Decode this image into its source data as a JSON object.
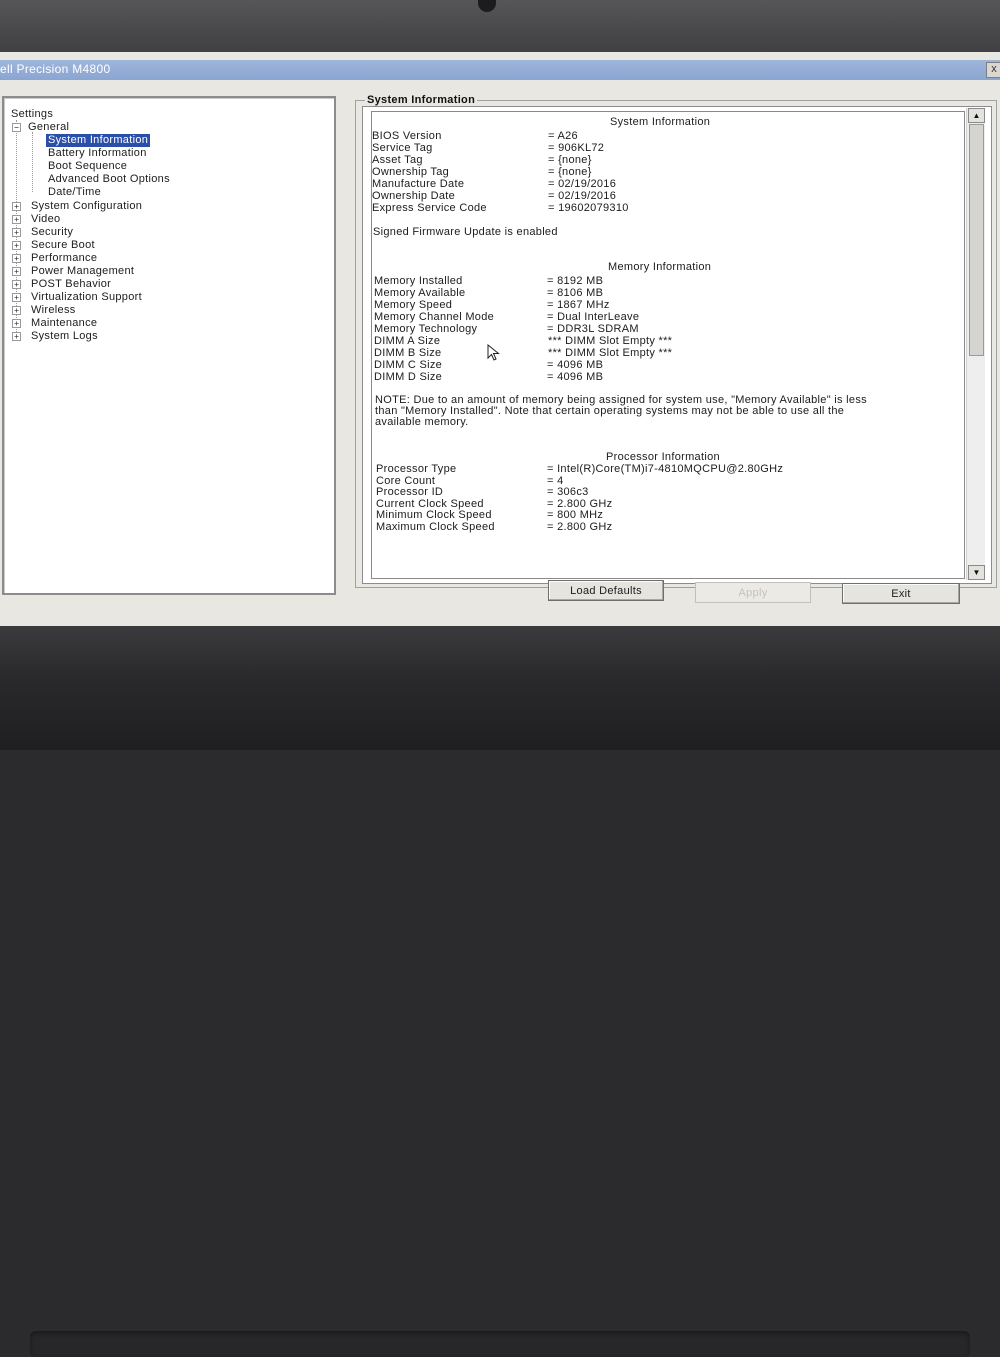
{
  "window": {
    "title": "ell Precision M4800",
    "close_label": "x"
  },
  "tree": {
    "root": "Settings",
    "general": "General",
    "general_items": [
      "System Information",
      "Battery Information",
      "Boot Sequence",
      "Advanced Boot Options",
      "Date/Time"
    ],
    "selected": "System Information",
    "categories": [
      "System Configuration",
      "Video",
      "Security",
      "Secure Boot",
      "Performance",
      "Power Management",
      "POST Behavior",
      "Virtualization Support",
      "Wireless",
      "Maintenance",
      "System Logs"
    ]
  },
  "group_title": "System Information",
  "system": {
    "heading": "System Information",
    "rows": [
      {
        "label": "BIOS Version",
        "value": "= A26"
      },
      {
        "label": "Service Tag",
        "value": "= 906KL72"
      },
      {
        "label": "Asset Tag",
        "value": "= {none}"
      },
      {
        "label": "Ownership Tag",
        "value": "= {none}"
      },
      {
        "label": "Manufacture Date",
        "value": "= 02/19/2016"
      },
      {
        "label": "Ownership Date",
        "value": "= 02/19/2016"
      },
      {
        "label": "Express Service Code",
        "value": "= 19602079310"
      }
    ],
    "firmware_note": "Signed Firmware Update is enabled"
  },
  "memory": {
    "heading": "Memory Information",
    "rows": [
      {
        "label": "Memory Installed",
        "value": "= 8192 MB"
      },
      {
        "label": "Memory Available",
        "value": "= 8106 MB"
      },
      {
        "label": "Memory Speed",
        "value": "= 1867 MHz"
      },
      {
        "label": "Memory Channel Mode",
        "value": "= Dual InterLeave"
      },
      {
        "label": "Memory Technology",
        "value": "= DDR3L SDRAM"
      },
      {
        "label": "DIMM A Size",
        "value": "*** DIMM Slot Empty ***"
      },
      {
        "label": "DIMM B Size",
        "value": "*** DIMM Slot Empty ***"
      },
      {
        "label": "DIMM C Size",
        "value": "= 4096 MB"
      },
      {
        "label": "DIMM D Size",
        "value": "= 4096 MB"
      }
    ],
    "note_lines": [
      "NOTE: Due to an amount of memory being assigned for system use, \"Memory Available\" is less",
      "than \"Memory Installed\". Note that certain operating systems may not be able to use all the",
      "available memory."
    ]
  },
  "processor": {
    "heading": "Processor Information",
    "rows": [
      {
        "label": "Processor Type",
        "value": "= Intel(R)Core(TM)i7-4810MQCPU@2.80GHz"
      },
      {
        "label": "Core Count",
        "value": "= 4"
      },
      {
        "label": "Processor ID",
        "value": "= 306c3"
      },
      {
        "label": "Current Clock Speed",
        "value": "= 2.800 GHz"
      },
      {
        "label": "Minimum Clock Speed",
        "value": "= 800 MHz"
      },
      {
        "label": "Maximum Clock Speed",
        "value": "= 2.800 GHz"
      }
    ]
  },
  "buttons": {
    "load_defaults": "Load Defaults",
    "apply": "Apply",
    "exit": "Exit"
  },
  "scroll": {
    "up_icon": "triangle-up",
    "down_icon": "triangle-down"
  }
}
